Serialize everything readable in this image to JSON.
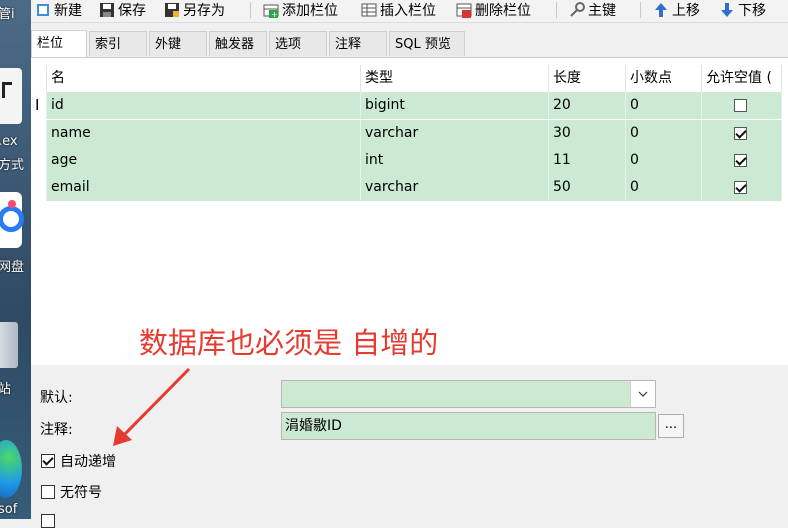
{
  "desktop": {
    "labels": [
      "管i",
      ".ex",
      "方式",
      "网盘",
      "站",
      "sof"
    ]
  },
  "toolbar": {
    "new_label": "新建",
    "save_label": "保存",
    "save_as_label": "另存为",
    "add_field_label": "添加栏位",
    "insert_field_label": "插入栏位",
    "delete_field_label": "删除栏位",
    "primary_key_label": "主键",
    "move_up_label": "上移",
    "move_down_label": "下移"
  },
  "tabs": [
    "栏位",
    "索引",
    "外键",
    "触发器",
    "选项",
    "注释",
    "SQL 预览"
  ],
  "grid": {
    "headers": [
      "名",
      "类型",
      "长度",
      "小数点",
      "允许空值 ("
    ],
    "cursor_marker": "I",
    "rows": [
      {
        "name": "id",
        "type": "bigint",
        "length": "20",
        "decimals": "0",
        "not_null": false
      },
      {
        "name": "name",
        "type": "varchar",
        "length": "30",
        "decimals": "0",
        "not_null": true
      },
      {
        "name": "age",
        "type": "int",
        "length": "11",
        "decimals": "0",
        "not_null": true
      },
      {
        "name": "email",
        "type": "varchar",
        "length": "50",
        "decimals": "0",
        "not_null": true
      }
    ]
  },
  "props": {
    "default_label": "默认:",
    "default_value": "",
    "comment_label": "注释:",
    "comment_value": "涓婚敭ID",
    "dots_label": "...",
    "auto_increment_label": "自动递增",
    "auto_increment_checked": true,
    "unsigned_label": "无符号",
    "unsigned_checked": false
  },
  "annotation": {
    "text": "数据库也必须是 自增的",
    "color": "#e53b30"
  }
}
